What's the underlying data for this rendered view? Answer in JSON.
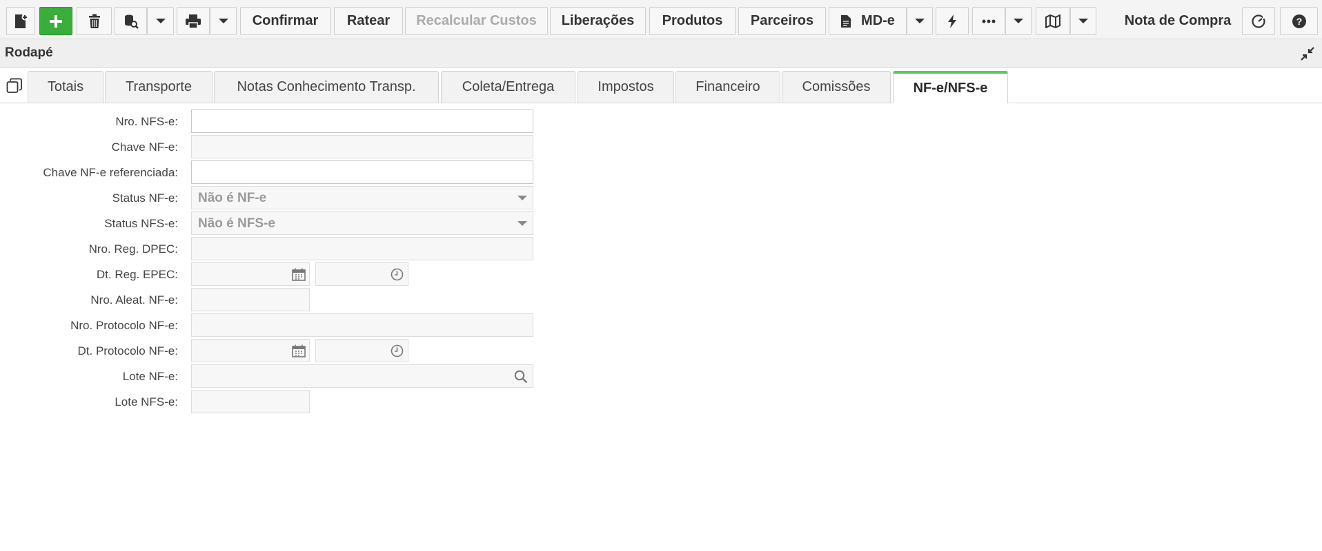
{
  "toolbar": {
    "new_icon": "new-document-icon",
    "add_icon": "plus-icon",
    "delete_icon": "trash-icon",
    "search_icon": "database-search-icon",
    "print_icon": "printer-icon",
    "confirmar": "Confirmar",
    "ratear": "Ratear",
    "recalcular": "Recalcular Custos",
    "liberacoes": "Liberações",
    "produtos": "Produtos",
    "parceiros": "Parceiros",
    "mde": "MD-e",
    "screen_title": "Nota de Compra",
    "accent_green": "#3aae3a"
  },
  "section": {
    "title": "Rodapé"
  },
  "tabs": [
    {
      "label": "Totais"
    },
    {
      "label": "Transporte"
    },
    {
      "label": "Notas Conhecimento Transp."
    },
    {
      "label": "Coleta/Entrega"
    },
    {
      "label": "Impostos"
    },
    {
      "label": "Financeiro"
    },
    {
      "label": "Comissões"
    },
    {
      "label": "NF-e/NFS-e"
    }
  ],
  "active_tab": "NF-e/NFS-e",
  "form": {
    "nro_nfse": {
      "label": "Nro. NFS-e:",
      "value": ""
    },
    "chave_nfe": {
      "label": "Chave NF-e:",
      "value": ""
    },
    "chave_ref": {
      "label": "Chave NF-e referenciada:",
      "value": ""
    },
    "status_nfe": {
      "label": "Status NF-e:",
      "value": "Não é NF-e"
    },
    "status_nfse": {
      "label": "Status NFS-e:",
      "value": "Não é NFS-e"
    },
    "nro_reg_dpec": {
      "label": "Nro. Reg. DPEC:",
      "value": ""
    },
    "dt_reg_epec": {
      "label": "Dt. Reg. EPEC:",
      "date": "",
      "time": ""
    },
    "nro_aleat": {
      "label": "Nro. Aleat. NF-e:",
      "value": ""
    },
    "nro_protocolo": {
      "label": "Nro. Protocolo NF-e:",
      "value": ""
    },
    "dt_protocolo": {
      "label": "Dt. Protocolo NF-e:",
      "date": "",
      "time": ""
    },
    "lote_nfe": {
      "label": "Lote NF-e:",
      "value": ""
    },
    "lote_nfse": {
      "label": "Lote NFS-e:",
      "value": ""
    }
  }
}
